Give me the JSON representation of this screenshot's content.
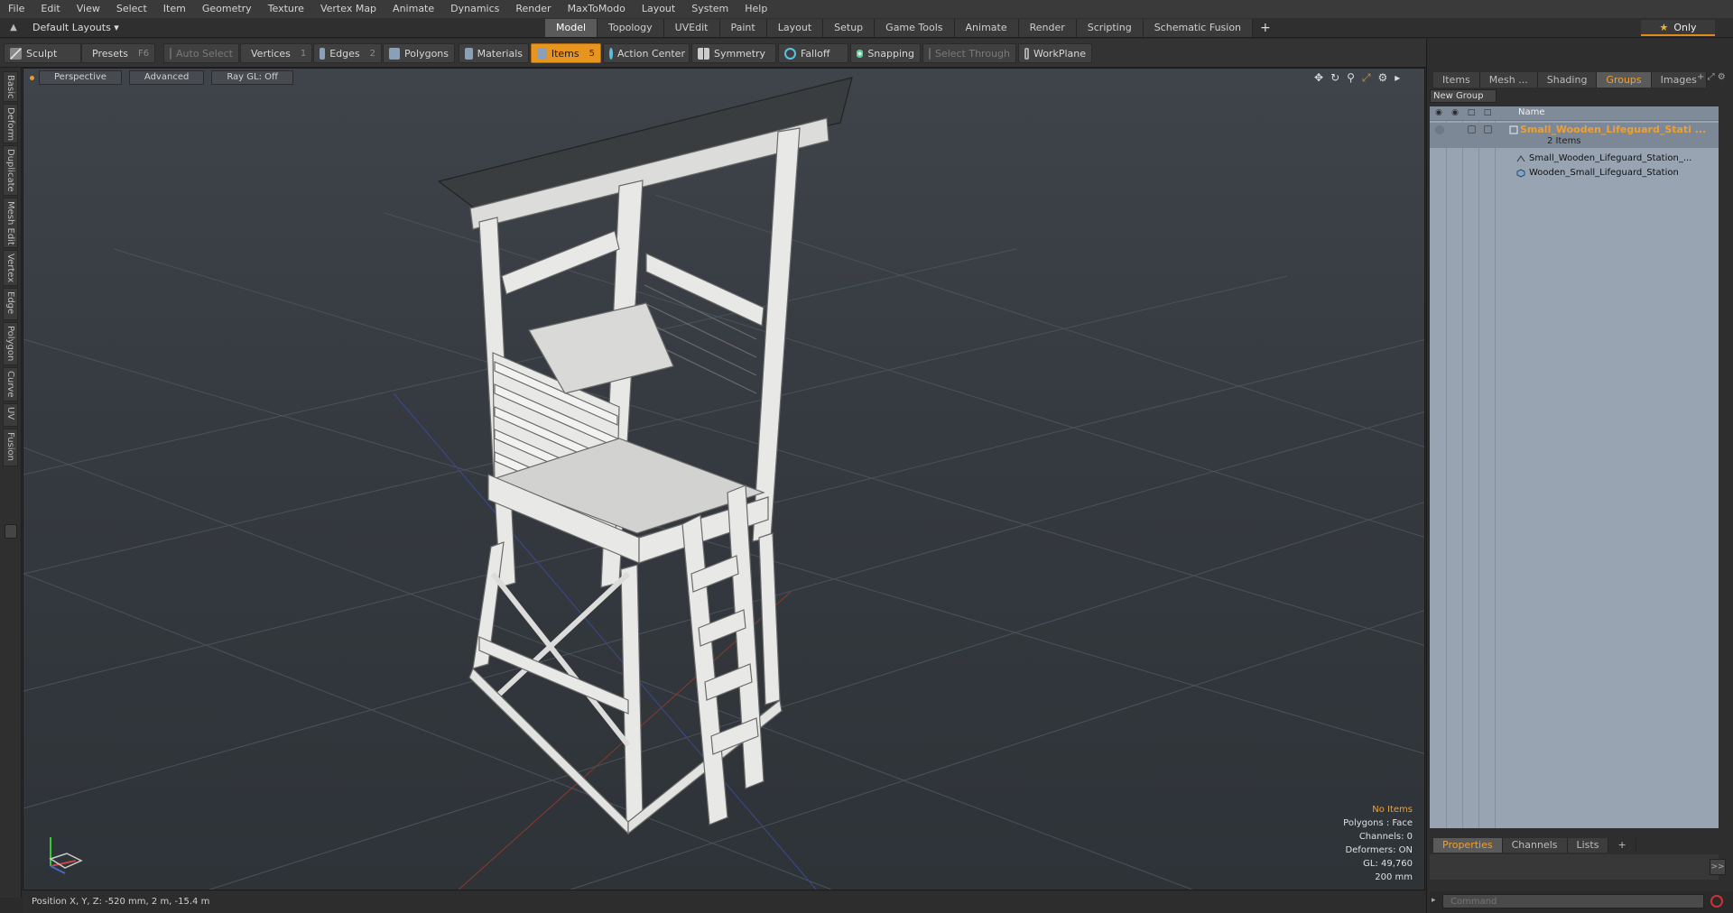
{
  "menu": [
    "File",
    "Edit",
    "View",
    "Select",
    "Item",
    "Geometry",
    "Texture",
    "Vertex Map",
    "Animate",
    "Dynamics",
    "Render",
    "MaxToModo",
    "Layout",
    "System",
    "Help"
  ],
  "layout": {
    "dropdown": "Default Layouts ▾"
  },
  "tabs": [
    "Model",
    "Topology",
    "UVEdit",
    "Paint",
    "Layout",
    "Setup",
    "Game Tools",
    "Animate",
    "Render",
    "Scripting",
    "Schematic Fusion"
  ],
  "tabs_add": "+",
  "only": {
    "star": "★",
    "label": "Only"
  },
  "toolbar": {
    "sculpt": "Sculpt",
    "presets": "Presets",
    "presets_key": "F6",
    "auto_select": "Auto Select",
    "vertices": "Vertices",
    "vertices_count": "1",
    "edges": "Edges",
    "edges_count": "2",
    "polygons": "Polygons",
    "materials": "Materials",
    "items": "Items",
    "items_count": "5",
    "action_center": "Action Center",
    "symmetry": "Symmetry",
    "falloff": "Falloff",
    "snapping": "Snapping",
    "select_through": "Select Through",
    "workplane": "WorkPlane"
  },
  "left_tabs": [
    "Basic",
    "Deform",
    "Duplicate",
    "Mesh Edit",
    "Vertex",
    "Edge",
    "Polygon",
    "Curve",
    "UV",
    "Fusion"
  ],
  "viewport": {
    "view": "Perspective",
    "shading": "Advanced",
    "raygl": "Ray GL: Off"
  },
  "hud": {
    "no_items": "No Items",
    "polygons": "Polygons : Face",
    "channels": "Channels: 0",
    "deformers": "Deformers: ON",
    "gl": "GL: 49,760",
    "grid": "200 mm"
  },
  "status": "Position X, Y, Z:   -520 mm, 2 m, -15.4 m",
  "right_panel": {
    "tabs": [
      "Items",
      "Mesh ...",
      "Shading",
      "Groups",
      "Images"
    ],
    "active_tab": "Groups",
    "new_group": "New Group",
    "name_header": "Name",
    "group": {
      "name": "Small_Wooden_Lifeguard_Stati ...",
      "count": "2 Items"
    },
    "children": [
      "Small_Wooden_Lifeguard_Station_...",
      "Wooden_Small_Lifeguard_Station"
    ]
  },
  "properties": {
    "tabs": [
      "Properties",
      "Channels",
      "Lists"
    ],
    "add": "+",
    "expand": ">>",
    "command_placeholder": "Command"
  },
  "colors": {
    "accent": "#e8951f",
    "list_bg": "#98a4b2",
    "viewport_bg": "#353a40"
  }
}
